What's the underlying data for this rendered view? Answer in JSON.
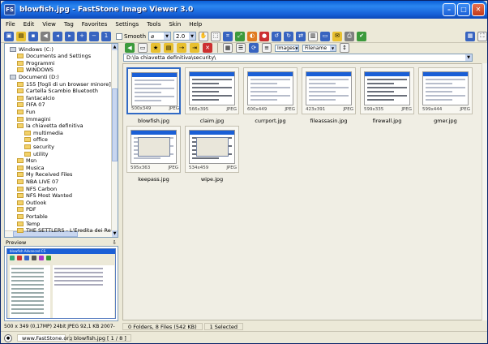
{
  "window": {
    "title": "blowfish.jpg - FastStone Image Viewer 3.0",
    "app_icon": "FS"
  },
  "menu": [
    "File",
    "Edit",
    "View",
    "Tag",
    "Favorites",
    "Settings",
    "Tools",
    "Skin",
    "Help"
  ],
  "toolbar": {
    "smooth_label": "Smooth",
    "zoom_value": "2.0"
  },
  "tree": [
    {
      "label": "Windows (C:)",
      "type": "drive",
      "indent": 1
    },
    {
      "label": "Documents and Settings",
      "type": "folder",
      "indent": 2
    },
    {
      "label": "Programmi",
      "type": "folder",
      "indent": 2
    },
    {
      "label": "WINDOWS",
      "type": "folder",
      "indent": 2
    },
    {
      "label": "Documenti (D:)",
      "type": "drive",
      "indent": 1
    },
    {
      "label": "155 [fogli di un browser minore]",
      "type": "folder",
      "indent": 2
    },
    {
      "label": "Cartella Scambio Bluetooth",
      "type": "folder",
      "indent": 2
    },
    {
      "label": "fantacalcio",
      "type": "folder",
      "indent": 2
    },
    {
      "label": "FIFA 07",
      "type": "folder",
      "indent": 2
    },
    {
      "label": "Fun",
      "type": "folder",
      "indent": 2
    },
    {
      "label": "Immagini",
      "type": "folder",
      "indent": 2
    },
    {
      "label": "la chiavetta definitiva",
      "type": "folder",
      "indent": 2
    },
    {
      "label": "multimedia",
      "type": "folder",
      "indent": 3
    },
    {
      "label": "office",
      "type": "folder",
      "indent": 3
    },
    {
      "label": "security",
      "type": "folder",
      "indent": 3
    },
    {
      "label": "utility",
      "type": "folder",
      "indent": 3
    },
    {
      "label": "Msn",
      "type": "folder",
      "indent": 2
    },
    {
      "label": "Musica",
      "type": "folder",
      "indent": 2
    },
    {
      "label": "My Received Files",
      "type": "folder",
      "indent": 2
    },
    {
      "label": "NBA LIVE 07",
      "type": "folder",
      "indent": 2
    },
    {
      "label": "NFS Carbon",
      "type": "folder",
      "indent": 2
    },
    {
      "label": "NFS Most Wanted",
      "type": "folder",
      "indent": 2
    },
    {
      "label": "Outlook",
      "type": "folder",
      "indent": 2
    },
    {
      "label": "PDF",
      "type": "folder",
      "indent": 2
    },
    {
      "label": "Portable",
      "type": "folder",
      "indent": 2
    },
    {
      "label": "Temp",
      "type": "folder",
      "indent": 2
    },
    {
      "label": "THE SETTLERS - L'Eredita dei Re",
      "type": "folder",
      "indent": 2
    }
  ],
  "preview": {
    "label": "Preview",
    "mini_title": "blowfish Advanced CS"
  },
  "image_info": "500 x 349 (0,17MP)  24bit JPEG  92,1 KB  2007-",
  "browser": {
    "filter": "Images",
    "sort": "Filename",
    "path": "D:\\la chiavetta definitiva\\security\\",
    "thumbnails": [
      {
        "name": "blowfish.jpg",
        "dims": "500x349",
        "fmt": "JPEG",
        "selected": true
      },
      {
        "name": "claim.jpg",
        "dims": "566x395",
        "fmt": "JPEG",
        "selected": false
      },
      {
        "name": "currport.jpg",
        "dims": "600x449",
        "fmt": "JPEG",
        "selected": false
      },
      {
        "name": "fileassasin.jpg",
        "dims": "423x391",
        "fmt": "JPEG",
        "selected": false
      },
      {
        "name": "firewall.jpg",
        "dims": "599x335",
        "fmt": "JPEG",
        "selected": false
      },
      {
        "name": "gmer.jpg",
        "dims": "599x444",
        "fmt": "JPEG",
        "selected": false
      },
      {
        "name": "keepass.jpg",
        "dims": "595x363",
        "fmt": "JPEG",
        "selected": false
      },
      {
        "name": "wipe.jpg",
        "dims": "534x459",
        "fmt": "JPEG",
        "selected": false
      }
    ]
  },
  "status": {
    "counts": "0 Folders, 8 Files (542 KB)",
    "selected": "1 Selected"
  },
  "bottom": {
    "website": "www.FastStone.org",
    "file_pos": "blowfish.jpg [ 1 / 8 ]"
  },
  "colors": {
    "title_bar": "#1661d8",
    "selection": "#316ac5",
    "window_bg": "#ece9d8"
  }
}
